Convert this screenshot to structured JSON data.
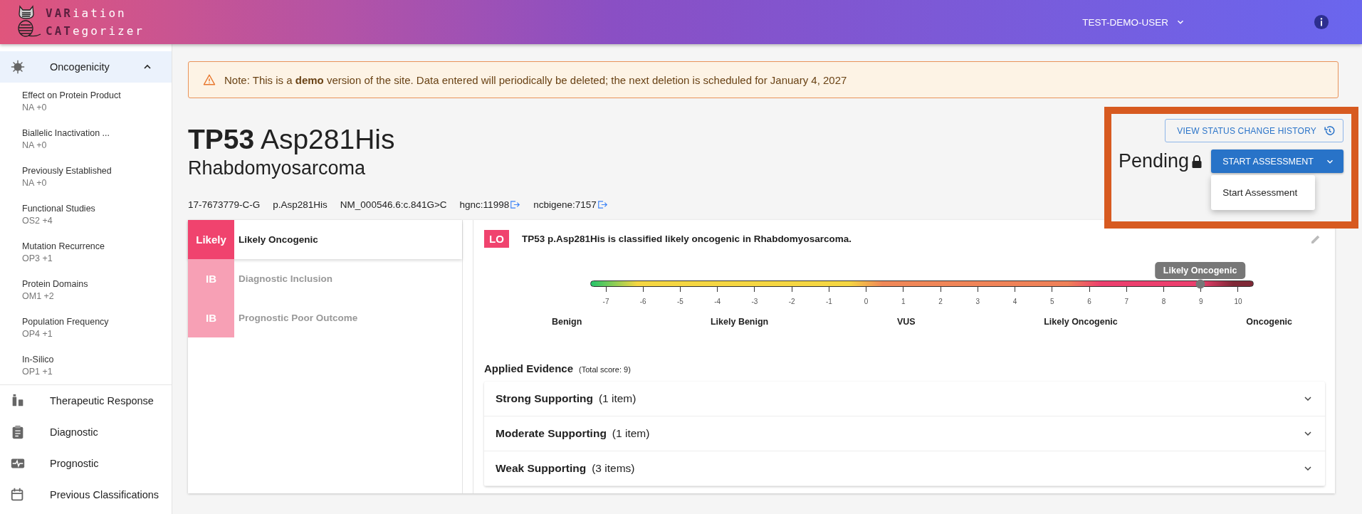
{
  "header": {
    "logo_lines": [
      {
        "strong": "VAR",
        "rest": "iation"
      },
      {
        "strong": "CAT",
        "rest": "egorizer"
      }
    ],
    "user": "TEST-DEMO-USER"
  },
  "sidebar": {
    "sections": [
      {
        "label": "Oncogenicity",
        "selected": true,
        "expanded": true,
        "children": [
          {
            "label": "Effect on Protein Product",
            "code": "NA +0"
          },
          {
            "label": "Biallelic Inactivation ...",
            "code": "NA +0"
          },
          {
            "label": "Previously Established",
            "code": "NA +0"
          },
          {
            "label": "Functional Studies",
            "code": "OS2 +4"
          },
          {
            "label": "Mutation Recurrence",
            "code": "OP3 +1"
          },
          {
            "label": "Protein Domains",
            "code": "OM1 +2"
          },
          {
            "label": "Population Frequency",
            "code": "OP4 +1"
          },
          {
            "label": "In-Silico",
            "code": "OP1 +1"
          }
        ]
      },
      {
        "label": "Therapeutic Response",
        "selected": false
      },
      {
        "label": "Diagnostic",
        "selected": false
      },
      {
        "label": "Prognostic",
        "selected": false
      },
      {
        "label": "Previous Classifications",
        "selected": false
      }
    ]
  },
  "alert": "Note: This is a **demo** version of the site. Data entered will periodically be deleted; the next deletion is scheduled for January 4, 2027",
  "variant": {
    "gene": "TP53",
    "change": "Asp281His",
    "disease": "Rhabdomyosarcoma",
    "identifiers": [
      {
        "text": "17-7673779-C-G",
        "link": false
      },
      {
        "text": "p.Asp281His",
        "link": false
      },
      {
        "text": "NM_000546.6:c.841G>C",
        "link": false
      },
      {
        "text": "hgnc:11998",
        "link": true
      },
      {
        "text": "ncbigene:7157",
        "link": true
      }
    ]
  },
  "status": {
    "history_button": "VIEW STATUS CHANGE HISTORY",
    "state": "Pending",
    "locked": true,
    "action_button": "START ASSESSMENT",
    "menu_items": [
      "Start Assessment"
    ]
  },
  "classification_tabs": [
    {
      "badge": "Likely",
      "label": "Likely Oncogenic",
      "selected": true
    },
    {
      "badge": "IB",
      "label": "Diagnostic Inclusion",
      "selected": false
    },
    {
      "badge": "IB",
      "label": "Prognostic Poor Outcome",
      "selected": false
    }
  ],
  "oncogenicity": {
    "badge": "LO",
    "summary": "TP53 p.Asp281His is classified likely oncogenic in Rhabdomyosarcoma.",
    "scale": {
      "ticks": [
        "-7",
        "-6",
        "-5",
        "-4",
        "-3",
        "-2",
        "-1",
        "0",
        "1",
        "2",
        "3",
        "4",
        "5",
        "6",
        "7",
        "8",
        "9",
        "10"
      ],
      "categories": [
        "Benign",
        "Likely Benign",
        "VUS",
        "Likely Oncogenic",
        "Oncogenic"
      ],
      "marker_label": "Likely Oncogenic",
      "level": 0.92
    },
    "evidence_title": "Applied Evidence",
    "total_score": "(Total score: 9)",
    "evidence_groups": [
      {
        "title": "Strong Supporting",
        "count": "(1 item)",
        "expanded": false
      },
      {
        "title": "Moderate Supporting",
        "count": "(1 item)",
        "expanded": false
      },
      {
        "title": "Weak Supporting",
        "count": "(3 items)",
        "expanded": false
      }
    ]
  }
}
